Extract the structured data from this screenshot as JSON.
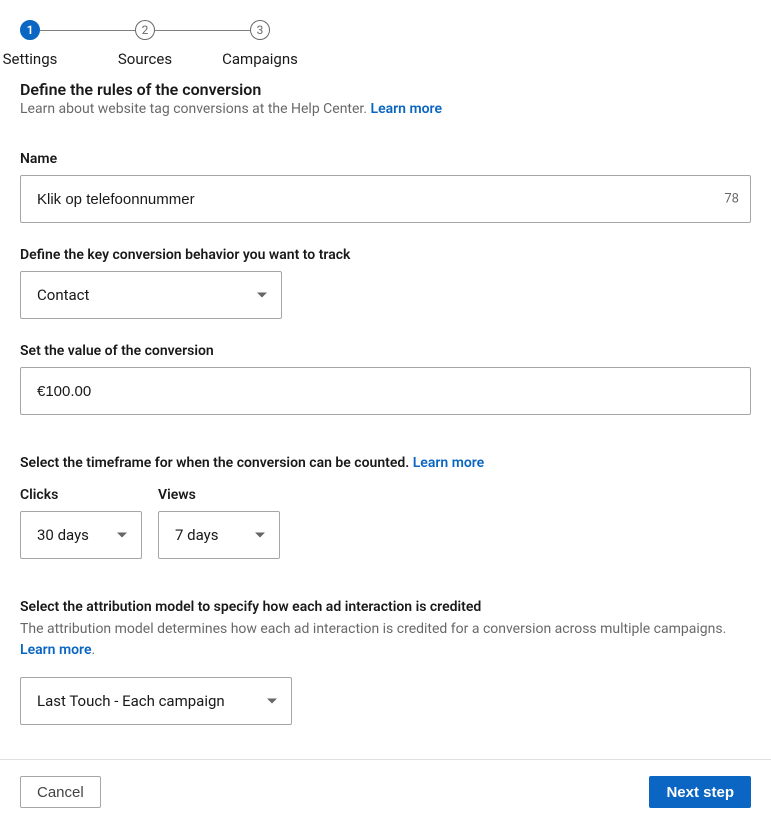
{
  "stepper": {
    "steps": [
      {
        "num": "1",
        "label": "Settings",
        "active": true
      },
      {
        "num": "2",
        "label": "Sources",
        "active": false
      },
      {
        "num": "3",
        "label": "Campaigns",
        "active": false
      }
    ]
  },
  "header": {
    "title": "Define the rules of the conversion",
    "subtitle_prefix": "Learn about website tag conversions at the Help Center. ",
    "learn_more": "Learn more"
  },
  "name_field": {
    "label": "Name",
    "value": "Klik op telefoonnummer",
    "char_count": "78"
  },
  "behavior": {
    "label": "Define the key conversion behavior you want to track",
    "selected": "Contact"
  },
  "value_field": {
    "label": "Set the value of the conversion",
    "value": "€100.00"
  },
  "timeframe": {
    "heading_prefix": "Select the timeframe for when the conversion can be counted. ",
    "learn_more": "Learn more",
    "clicks": {
      "label": "Clicks",
      "selected": "30 days"
    },
    "views": {
      "label": "Views",
      "selected": "7 days"
    }
  },
  "attribution": {
    "heading": "Select the attribution model to specify how each ad interaction is credited",
    "description_prefix": "The attribution model determines how each ad interaction is credited for a conversion across multiple campaigns. ",
    "learn_more": "Learn more",
    "period": ".",
    "selected": "Last Touch - Each campaign"
  },
  "footer": {
    "cancel": "Cancel",
    "next": "Next step"
  }
}
